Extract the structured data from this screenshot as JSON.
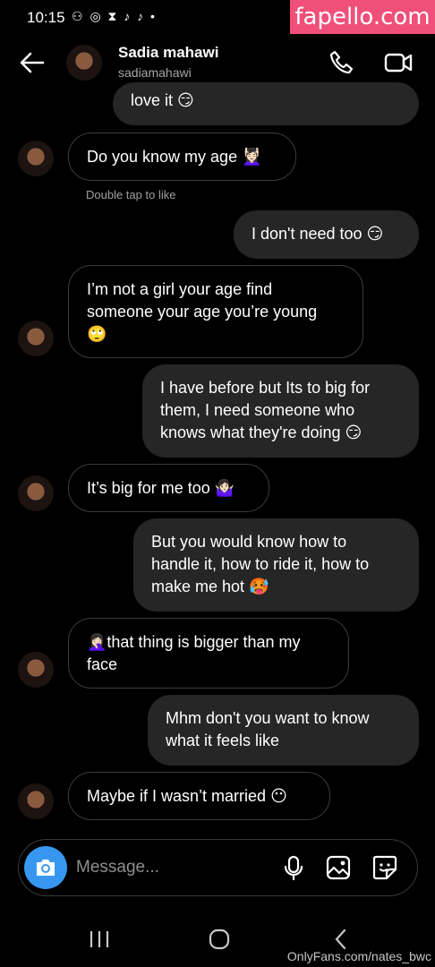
{
  "status_bar": {
    "time": "10:15",
    "icons": "⚇ ◎ ⧗ ♪ ♪ •"
  },
  "watermark_top": "fapello.com",
  "header": {
    "name": "Sadia mahawi",
    "username": "sadiamahawi"
  },
  "messages": [
    {
      "side": "sent",
      "lines": [
        "love it 😏"
      ]
    },
    {
      "side": "received",
      "lines": [
        "Do you know my age 💆🏻‍♀️"
      ]
    },
    {
      "side": "sent",
      "lines": [
        "I don't need too 😏"
      ]
    },
    {
      "side": "received",
      "lines": [
        "I’m not a girl your age find",
        "someone your age you’re young",
        "🙄"
      ]
    },
    {
      "side": "sent",
      "lines": [
        "I have before but Its to big for",
        "them, I need someone who",
        "knows what they're doing 😏"
      ]
    },
    {
      "side": "received",
      "lines": [
        "It’s big for me too 🤷🏻‍♀️"
      ]
    },
    {
      "side": "sent",
      "lines": [
        "But you would know how to",
        "handle it, how to ride it, how to",
        "make me hot 🥵"
      ]
    },
    {
      "side": "received",
      "lines": [
        "🤦🏻‍♀️that thing is bigger than my",
        "face"
      ]
    },
    {
      "side": "sent",
      "lines": [
        "Mhm don't you want to know",
        "what it feels like"
      ]
    },
    {
      "side": "received",
      "lines": [
        "Maybe if I wasn’t married 😶"
      ]
    }
  ],
  "double_tap_hint": "Double tap to like",
  "composer": {
    "placeholder": "Message..."
  },
  "icons": {
    "back": "back-arrow-icon",
    "call": "phone-icon",
    "video": "video-camera-icon",
    "camera": "camera-icon",
    "mic": "microphone-icon",
    "gallery": "image-icon",
    "sticker": "sticker-icon"
  },
  "colors": {
    "camera_button": "#3797f0",
    "sent_bubble": "#262626",
    "watermark": "#ef4f79"
  },
  "watermark_bottom": "OnlyFans.com/nates_bwc"
}
